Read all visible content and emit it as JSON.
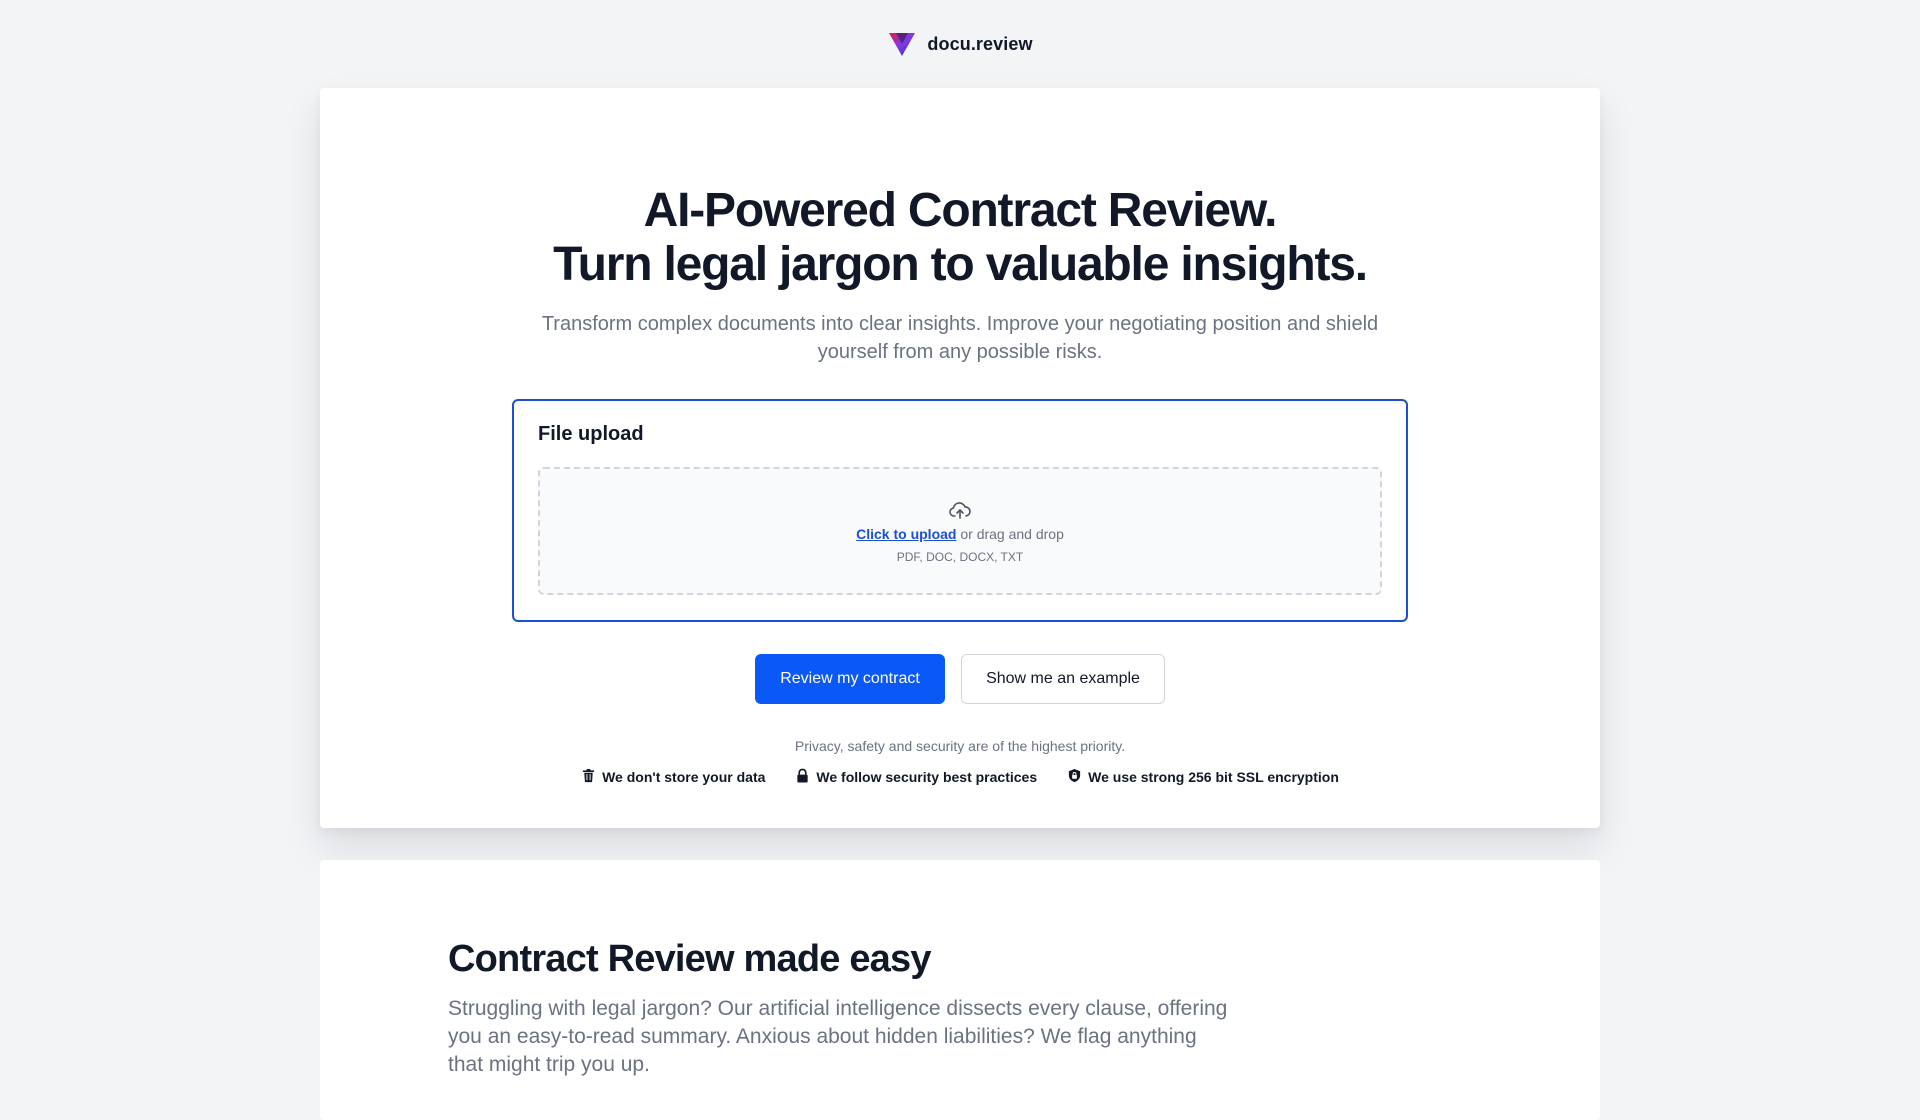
{
  "header": {
    "brand": "docu.review",
    "logo_icon": "docu-review-logo-icon"
  },
  "hero": {
    "title_line1": "AI-Powered Contract Review.",
    "title_line2": "Turn legal jargon to valuable insights.",
    "subtitle": "Transform complex documents into clear insights. Improve your negotiating position and shield yourself from any possible risks."
  },
  "upload": {
    "title": "File upload",
    "icon": "cloud-upload-icon",
    "link_text": "Click to upload",
    "drag_text": " or drag and drop",
    "formats": "PDF, DOC, DOCX, TXT"
  },
  "actions": {
    "primary_label": "Review my contract",
    "secondary_label": "Show me an example"
  },
  "privacy": {
    "note": "Privacy, safety and security are of the highest priority.",
    "badges": [
      {
        "icon": "trash-icon",
        "label": "We don't store your data"
      },
      {
        "icon": "lock-icon",
        "label": "We follow security best practices"
      },
      {
        "icon": "shield-lock-icon",
        "label": "We use strong 256 bit SSL encryption"
      }
    ]
  },
  "section": {
    "title": "Contract Review made easy",
    "body": "Struggling with legal jargon? Our artificial intelligence dissects every clause, offering you an easy-to-read summary. Anxious about hidden liabilities? We flag anything that might trip you up."
  },
  "colors": {
    "accent": "#0a58f5",
    "upload_border": "#1d4fd6",
    "background": "#f3f4f6",
    "text_primary": "#111827",
    "text_muted": "#6b7280"
  }
}
